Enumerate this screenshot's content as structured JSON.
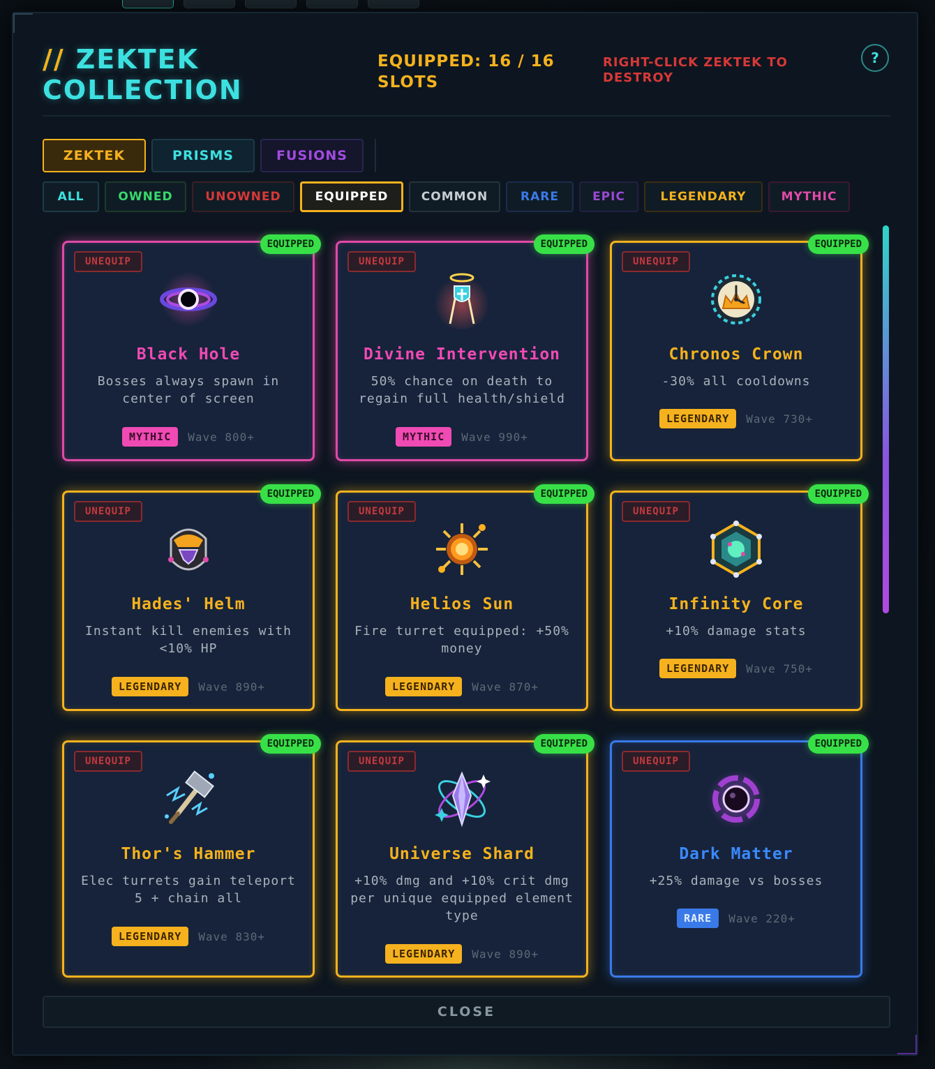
{
  "header": {
    "title_prefix": "//",
    "title_line1": "ZEKTEK",
    "title_line2": "COLLECTION",
    "equipped_line1": "EQUIPPED: 16 / 16",
    "equipped_line2": "SLOTS",
    "destroy_hint_line1": "RIGHT-CLICK ZEKTEK TO",
    "destroy_hint_line2": "DESTROY",
    "help_label": "?"
  },
  "tabs": [
    {
      "label": "ZEKTEK",
      "active": true
    },
    {
      "label": "PRISMS",
      "active": false
    },
    {
      "label": "FUSIONS",
      "active": false
    }
  ],
  "filters": [
    {
      "label": "ALL"
    },
    {
      "label": "OWNED"
    },
    {
      "label": "UNOWNED"
    },
    {
      "label": "EQUIPPED",
      "active": true
    },
    {
      "label": "COMMON"
    },
    {
      "label": "RARE"
    },
    {
      "label": "EPIC"
    },
    {
      "label": "LEGENDARY"
    },
    {
      "label": "MYTHIC"
    }
  ],
  "card_labels": {
    "unequip": "UNEQUIP",
    "equipped": "EQUIPPED"
  },
  "cards": [
    {
      "name": "Black Hole",
      "desc": "Bosses always spawn in center of screen",
      "rarity": "MYTHIC",
      "wave": "Wave 800+",
      "icon": "black-hole-icon"
    },
    {
      "name": "Divine Intervention",
      "desc": "50% chance on death to regain full health/shield",
      "rarity": "MYTHIC",
      "wave": "Wave 990+",
      "icon": "angel-shield-icon"
    },
    {
      "name": "Chronos Crown",
      "desc": "-30% all cooldowns",
      "rarity": "LEGENDARY",
      "wave": "Wave 730+",
      "icon": "clock-crown-icon"
    },
    {
      "name": "Hades' Helm",
      "desc": "Instant kill enemies with <10% HP",
      "rarity": "LEGENDARY",
      "wave": "Wave 890+",
      "icon": "helm-icon"
    },
    {
      "name": "Helios Sun",
      "desc": "Fire turret equipped: +50% money",
      "rarity": "LEGENDARY",
      "wave": "Wave 870+",
      "icon": "sun-icon"
    },
    {
      "name": "Infinity Core",
      "desc": "+10% damage stats",
      "rarity": "LEGENDARY",
      "wave": "Wave 750+",
      "icon": "hex-core-icon"
    },
    {
      "name": "Thor's Hammer",
      "desc": "Elec turrets gain teleport 5 + chain all",
      "rarity": "LEGENDARY",
      "wave": "Wave 830+",
      "icon": "hammer-icon"
    },
    {
      "name": "Universe Shard",
      "desc": "+10% dmg and +10% crit dmg per unique equipped element type",
      "rarity": "LEGENDARY",
      "wave": "Wave 890+",
      "icon": "crystal-shard-icon"
    },
    {
      "name": "Dark Matter",
      "desc": "+25% damage vs bosses",
      "rarity": "RARE",
      "wave": "Wave 220+",
      "icon": "dark-orb-icon"
    }
  ],
  "close_label": "CLOSE",
  "colors": {
    "mythic": "#e04aa8",
    "legendary": "#f5b21e",
    "rare": "#3a7ae8",
    "equipped_badge": "#38e048",
    "accent_cyan": "#3de0e0",
    "danger": "#d83838"
  }
}
